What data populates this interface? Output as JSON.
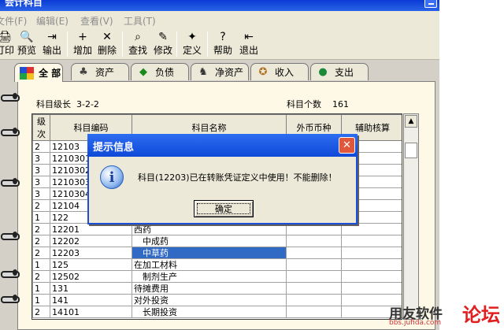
{
  "window": {
    "title": "会计科目"
  },
  "menu": [
    "文件(F)",
    "编辑(E)",
    "查看(V)",
    "工具(T)"
  ],
  "toolbar": [
    {
      "label": "打印",
      "icon": "printer-icon",
      "glyph": "🖨"
    },
    {
      "label": "预览",
      "icon": "preview-icon",
      "glyph": "🔍"
    },
    {
      "label": "输出",
      "icon": "export-icon",
      "glyph": "⇥"
    },
    {
      "label": "增加",
      "icon": "add-icon",
      "glyph": "+"
    },
    {
      "label": "删除",
      "icon": "delete-icon",
      "glyph": "✕"
    },
    {
      "label": "查找",
      "icon": "find-icon",
      "glyph": "⌕"
    },
    {
      "label": "修改",
      "icon": "edit-icon",
      "glyph": "✎"
    },
    {
      "label": "定义",
      "icon": "define-icon",
      "glyph": "✦"
    },
    {
      "label": "帮助",
      "icon": "help-icon",
      "glyph": "?"
    },
    {
      "label": "退出",
      "icon": "exit-icon",
      "glyph": "⇤"
    }
  ],
  "tabs": [
    {
      "label": "全 部",
      "icon": "all-icon",
      "glyph": "■",
      "color": "#e0302a"
    },
    {
      "label": "资产",
      "icon": "assets-icon",
      "glyph": "♣",
      "color": "#444444"
    },
    {
      "label": "负债",
      "icon": "liabilities-icon",
      "glyph": "◆",
      "color": "#1a8a1a"
    },
    {
      "label": "净资产",
      "icon": "net-assets-icon",
      "glyph": "♞",
      "color": "#333333"
    },
    {
      "label": "收入",
      "icon": "income-icon",
      "glyph": "✪",
      "color": "#b07020"
    },
    {
      "label": "支出",
      "icon": "expense-icon",
      "glyph": "●",
      "color": "#1a8a3a"
    }
  ],
  "info": {
    "level_label": "科目级长",
    "level_value": "3-2-2",
    "count_label": "科目个数",
    "count_value": "161"
  },
  "table": {
    "headers": [
      "级次",
      "科目编码",
      "科目名称",
      "外币币种",
      "辅助核算"
    ],
    "rows": [
      [
        "2",
        "12103",
        "",
        "",
        ""
      ],
      [
        "3",
        "1210301",
        "",
        "",
        ""
      ],
      [
        "3",
        "1210302",
        "",
        "",
        ""
      ],
      [
        "3",
        "1210303",
        "",
        "",
        ""
      ],
      [
        "3",
        "1210304",
        "",
        "",
        ""
      ],
      [
        "2",
        "12104",
        "",
        "",
        ""
      ],
      [
        "1",
        "122",
        "",
        "",
        ""
      ],
      [
        "2",
        "12201",
        "西药",
        "",
        ""
      ],
      [
        "2",
        "12202",
        "　中成药",
        "",
        ""
      ],
      [
        "2",
        "12203",
        "　中草药",
        "",
        ""
      ],
      [
        "1",
        "125",
        "在加工材料",
        "",
        ""
      ],
      [
        "2",
        "12502",
        "　制剂生产",
        "",
        ""
      ],
      [
        "1",
        "131",
        "待摊费用",
        "",
        ""
      ],
      [
        "1",
        "141",
        "对外投资",
        "",
        ""
      ],
      [
        "2",
        "14101",
        "　长期投资",
        "",
        ""
      ]
    ],
    "selected_index": 9
  },
  "dialog": {
    "title": "提示信息",
    "message": "科目(12203)已在转账凭证定义中使用！不能删除！",
    "ok_label": "确定",
    "close_glyph": "✕",
    "info_glyph": "i"
  },
  "watermark": {
    "brand": "用友软件",
    "forum": "论坛",
    "url": "bbs.jufida.com"
  },
  "colors": {
    "title_bar": "#0a3bd4",
    "selection": "#316ac5",
    "close_button": "#e0573c"
  }
}
